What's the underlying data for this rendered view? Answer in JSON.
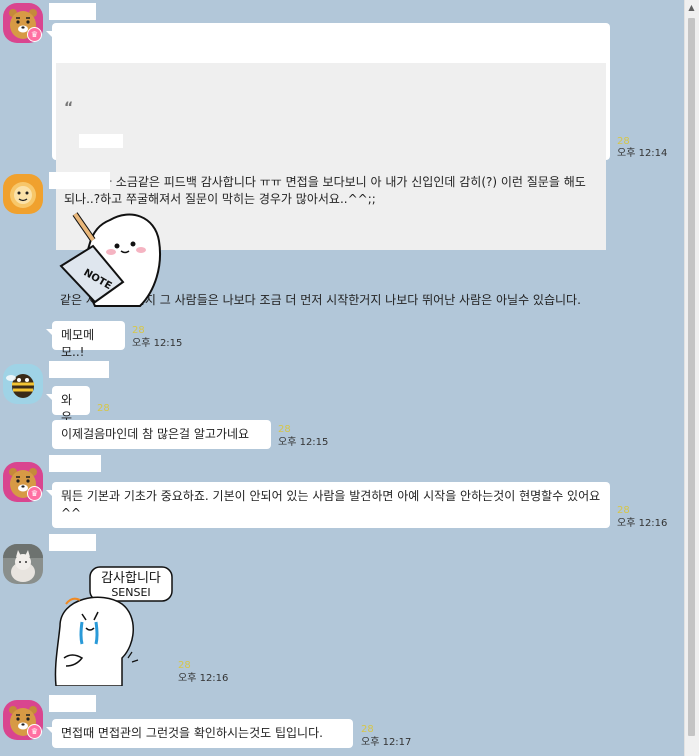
{
  "messages": {
    "m1": {
      "quote_mark": "“",
      "quote_text": "와아 빛과 소금같은 피드백 감사합니다 ㅠㅠ 면접을 보다보니 아 내가 신입인데 감히(?) 이런 질문을 해도 되나..?하고 쭈굴해져서 질문이 막히는 경우가 많아서요..^^;;",
      "reply": "같은 사람이고 단지 그 사람들은 나보다 조금 더 먼저 시작한거지 나보다 뛰어난 사람은 아닐수 있습니다.",
      "unread": "28",
      "time": "오후 12:14"
    },
    "m2": {
      "sticker": "NOTE",
      "text": "메모메모..!",
      "unread": "28",
      "time": "오후 12:15"
    },
    "m3": {
      "text1": "와우",
      "unread1": "28",
      "text2": "이제걸음마인데 참 많은걸 알고가네요",
      "unread2": "28",
      "time": "오후 12:15"
    },
    "m4": {
      "text": "뭐든 기본과 기초가 중요하죠. 기본이 안되어 있는 사람을 발견하면 아예 시작을 안하는것이 현명할수 있어요 ^^",
      "unread": "28",
      "time": "오후 12:16"
    },
    "m5": {
      "sticker_line1": "감사합니다",
      "sticker_line2": "SENSEI",
      "unread": "28",
      "time": "오후 12:16"
    },
    "m6": {
      "text": "면접때 면접관의 그런것을 확인하시는것도 팁입니다.",
      "unread": "28",
      "time": "오후 12:17"
    }
  },
  "icons": {
    "crown": "♛",
    "scroll_up": "▲"
  },
  "colors": {
    "background": "#b2c7d9",
    "bubble": "#ffffff",
    "unread": "#d6c64a",
    "crown_badge": "#ff6fa2"
  }
}
